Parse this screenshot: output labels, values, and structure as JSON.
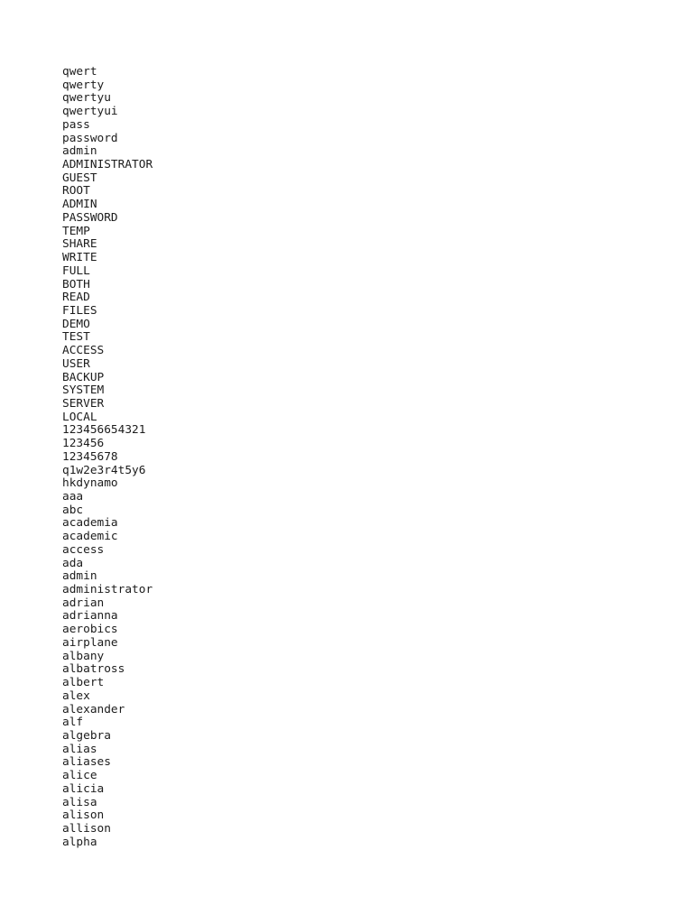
{
  "document": {
    "type": "plain-text-wordlist",
    "background_color": "#ffffff",
    "text_color": "#1c1c1c",
    "line_count": 59,
    "lines": [
      "qwert",
      "qwerty",
      "qwertyu",
      "qwertyui",
      "pass",
      "password",
      "admin",
      "ADMINISTRATOR",
      "GUEST",
      "ROOT",
      "ADMIN",
      "PASSWORD",
      "TEMP",
      "SHARE",
      "WRITE",
      "FULL",
      "BOTH",
      "READ",
      "FILES",
      "DEMO",
      "TEST",
      "ACCESS",
      "USER",
      "BACKUP",
      "SYSTEM",
      "SERVER",
      "LOCAL",
      "123456654321",
      "123456",
      "12345678",
      "q1w2e3r4t5y6",
      "hkdynamo",
      "aaa",
      "abc",
      "academia",
      "academic",
      "access",
      "ada",
      "admin",
      "administrator",
      "adrian",
      "adrianna",
      "aerobics",
      "airplane",
      "albany",
      "albatross",
      "albert",
      "alex",
      "alexander",
      "alf",
      "algebra",
      "alias",
      "aliases",
      "alice",
      "alicia",
      "alisa",
      "alison",
      "allison",
      "alpha"
    ]
  }
}
